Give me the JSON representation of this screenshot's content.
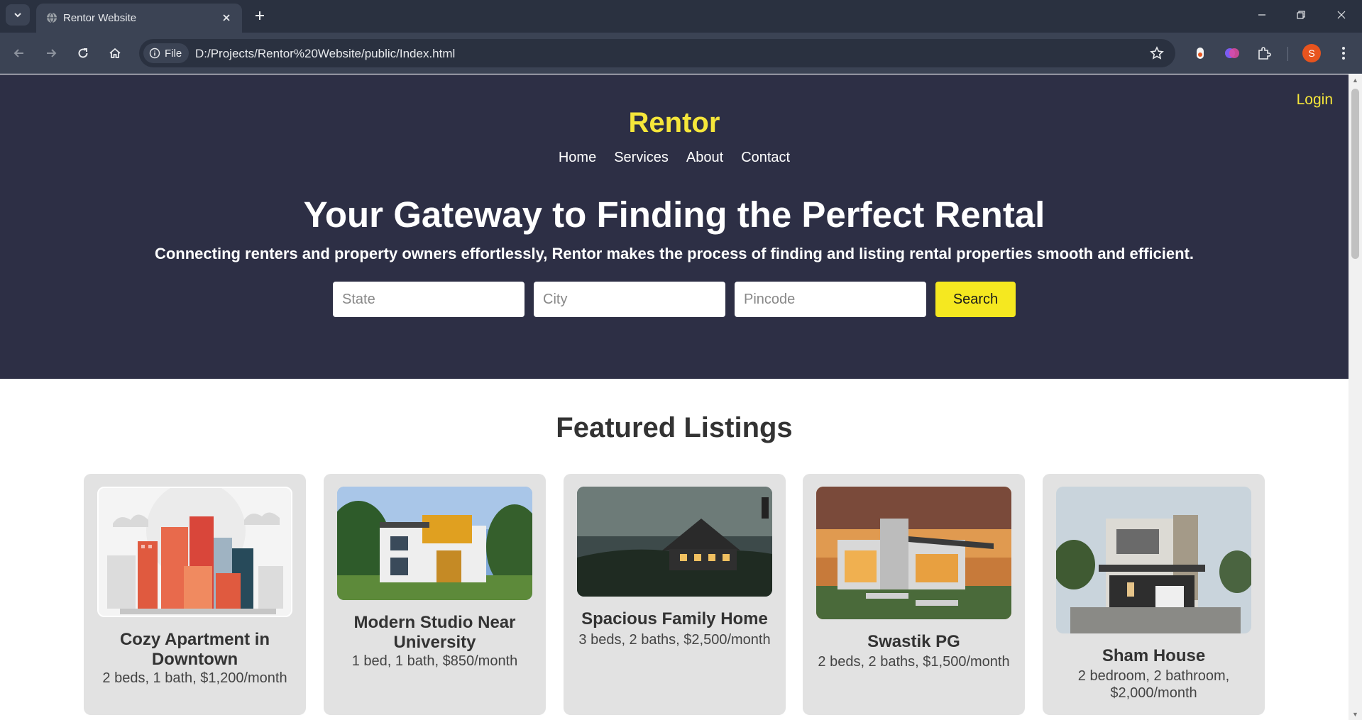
{
  "browser": {
    "tab_title": "Rentor Website",
    "url_chip": "File",
    "url": "D:/Projects/Rentor%20Website/public/Index.html",
    "profile_initial": "S",
    "icons": [
      "tab-list-icon",
      "globe-icon",
      "close-icon",
      "plus-icon",
      "minimize-icon",
      "restore-icon",
      "window-close-icon",
      "back-icon",
      "forward-icon",
      "reload-icon",
      "home-icon",
      "info-icon",
      "star-icon",
      "extension-icon",
      "kebab-menu-icon"
    ]
  },
  "header": {
    "login": "Login",
    "brand": "Rentor",
    "nav": [
      "Home",
      "Services",
      "About",
      "Contact"
    ]
  },
  "hero": {
    "headline": "Your Gateway to Finding the Perfect Rental",
    "subline": "Connecting renters and property owners effortlessly, Rentor makes the process of finding and listing rental properties smooth and efficient.",
    "state_placeholder": "State",
    "city_placeholder": "City",
    "pincode_placeholder": "Pincode",
    "search_label": "Search"
  },
  "featured": {
    "title": "Featured Listings",
    "listings": [
      {
        "title": "Cozy Apartment in Downtown",
        "desc": "2 beds, 1 bath, $1,200/month"
      },
      {
        "title": "Modern Studio Near University",
        "desc": "1 bed, 1 bath, $850/month"
      },
      {
        "title": "Spacious Family Home",
        "desc": "3 beds, 2 baths, $2,500/month"
      },
      {
        "title": "Swastik PG",
        "desc": "2 beds, 2 baths, $1,500/month"
      },
      {
        "title": "Sham House",
        "desc": "2 bedroom, 2 bathroom, $2,000/month"
      }
    ]
  },
  "colors": {
    "hero_bg": "#2d2f45",
    "accent_yellow": "#f5e63a",
    "search_button": "#f5e820",
    "card_bg": "#e2e2e2",
    "chrome_dark": "#2a3140",
    "chrome_toolbar": "#3b4354"
  }
}
